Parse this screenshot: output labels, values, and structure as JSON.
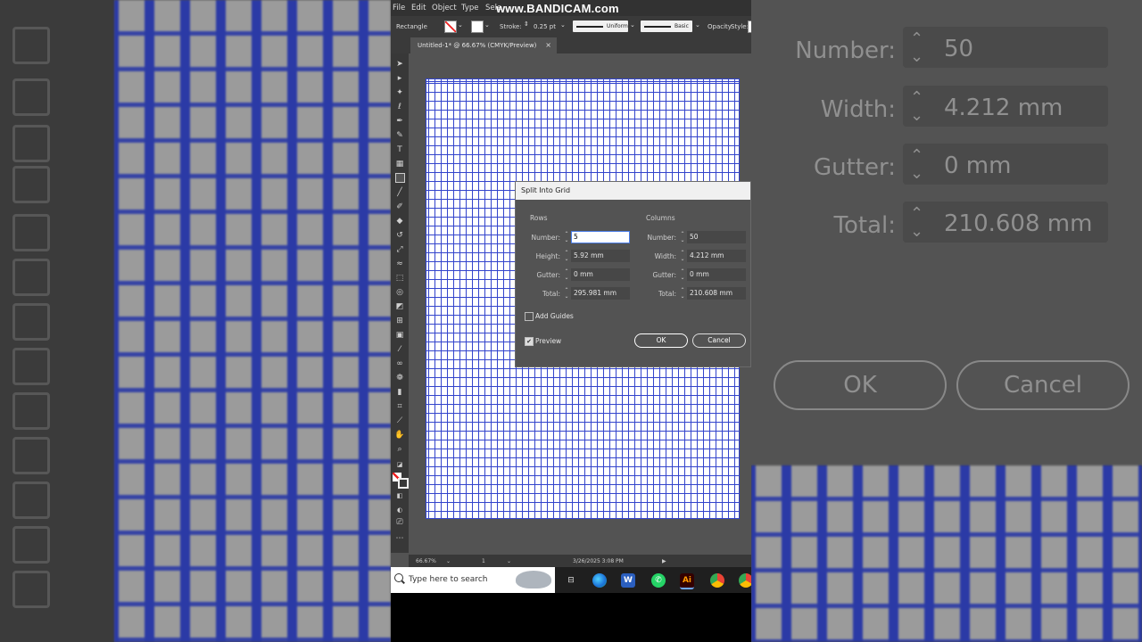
{
  "recorder_watermark": "www.BANDICAM.com",
  "menu": [
    "File",
    "Edit",
    "Object",
    "Type",
    "Sele"
  ],
  "control_bar": {
    "tool_name": "Rectangle",
    "stroke_label": "Stroke:",
    "stroke_value": "0.25 pt",
    "profile_value": "Uniform",
    "brush_value": "Basic",
    "opacity_label": "Opacity",
    "style_label": "Style:"
  },
  "document_tab": {
    "title": "Untitled-1* @ 66.67% (CMYK/Preview)",
    "close": "×"
  },
  "dialog": {
    "title": "Split Into Grid",
    "rows": {
      "label": "Rows",
      "number_label": "Number:",
      "number_value": "5",
      "height_label": "Height:",
      "height_value": "5.92 mm",
      "gutter_label": "Gutter:",
      "gutter_value": "0 mm",
      "total_label": "Total:",
      "total_value": "295.981 mm"
    },
    "columns": {
      "label": "Columns",
      "number_label": "Number:",
      "number_value": "50",
      "width_label": "Width:",
      "width_value": "4.212 mm",
      "gutter_label": "Gutter:",
      "gutter_value": "0 mm",
      "total_label": "Total:",
      "total_value": "210.608 mm"
    },
    "add_guides_label": "Add Guides",
    "add_guides_checked": false,
    "preview_label": "Preview",
    "preview_checked": true,
    "ok_label": "OK",
    "cancel_label": "Cancel"
  },
  "status_bar": {
    "zoom": "66.67%",
    "artboard": "1",
    "datetime": "3/26/2025  3:08 PM"
  },
  "taskbar": {
    "search_placeholder": "Type here to search",
    "apps": [
      "task-view",
      "edge",
      "word",
      "whatsapp",
      "illustrator",
      "chrome",
      "chrome"
    ],
    "illustrator_label": "Ai",
    "word_label": "W"
  },
  "zoomed": {
    "number_label": "Number:",
    "number_value": "50",
    "width_label": "Width:",
    "width_value": "4.212 mm",
    "gutter_label": "Gutter:",
    "gutter_value": "0 mm",
    "total_label": "Total:",
    "total_value": "210.608 mm",
    "ok_label": "OK",
    "cancel_label": "Cancel"
  },
  "colors": {
    "grid_line": "#3344cc",
    "ui_dark": "#323232",
    "ui_panel": "#535353",
    "illustrator_orange": "#ff9a00"
  }
}
